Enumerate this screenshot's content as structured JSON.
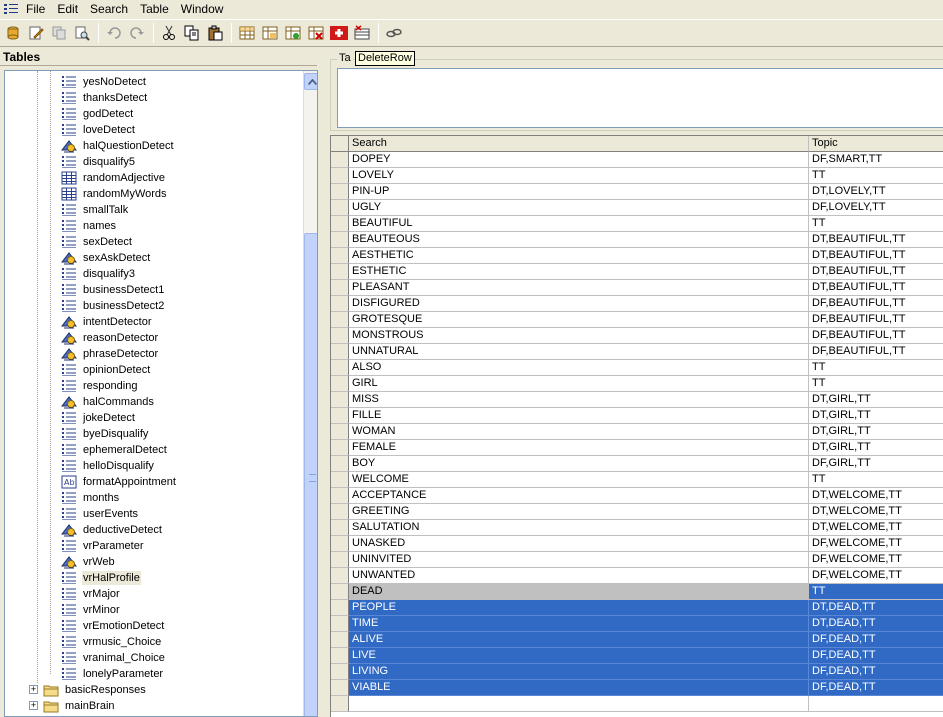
{
  "menu": [
    "File",
    "Edit",
    "Search",
    "Table",
    "Window"
  ],
  "toolbar": {
    "buttons": [
      "db-icon",
      "edit-icon",
      "copy-disabled-icon",
      "find-db-icon",
      "undo-icon",
      "redo-icon",
      "cut-icon",
      "copy-icon",
      "paste-icon",
      "table-icon",
      "table-props-icon",
      "table-add-icon",
      "table-delete-icon",
      "add-row-icon",
      "delete-row-icon",
      "link-icon"
    ]
  },
  "left_panel": {
    "title": "Tables",
    "items": [
      {
        "label": "yesNoDetect",
        "icon": "list-icon"
      },
      {
        "label": "thanksDetect",
        "icon": "list-icon"
      },
      {
        "label": "godDetect",
        "icon": "list-icon"
      },
      {
        "label": "loveDetect",
        "icon": "list-icon"
      },
      {
        "label": "halQuestionDetect",
        "icon": "query-icon"
      },
      {
        "label": "disqualify5",
        "icon": "list-icon"
      },
      {
        "label": "randomAdjective",
        "icon": "grid-icon"
      },
      {
        "label": "randomMyWords",
        "icon": "grid-icon"
      },
      {
        "label": "smallTalk",
        "icon": "list-icon"
      },
      {
        "label": "names",
        "icon": "list-icon"
      },
      {
        "label": "sexDetect",
        "icon": "list-icon"
      },
      {
        "label": "sexAskDetect",
        "icon": "query-icon"
      },
      {
        "label": "disqualify3",
        "icon": "list-icon"
      },
      {
        "label": "businessDetect1",
        "icon": "list-icon"
      },
      {
        "label": "businessDetect2",
        "icon": "list-icon"
      },
      {
        "label": "intentDetector",
        "icon": "query-icon"
      },
      {
        "label": "reasonDetector",
        "icon": "query-icon"
      },
      {
        "label": "phraseDetector",
        "icon": "query-icon"
      },
      {
        "label": "opinionDetect",
        "icon": "list-icon"
      },
      {
        "label": "responding",
        "icon": "list-icon"
      },
      {
        "label": "halCommands",
        "icon": "query-icon"
      },
      {
        "label": "jokeDetect",
        "icon": "list-icon"
      },
      {
        "label": "byeDisqualify",
        "icon": "list-icon"
      },
      {
        "label": "ephemeralDetect",
        "icon": "list-icon"
      },
      {
        "label": "helloDisqualify",
        "icon": "list-icon"
      },
      {
        "label": "formatAppointment",
        "icon": "format-icon"
      },
      {
        "label": "months",
        "icon": "list-icon"
      },
      {
        "label": "userEvents",
        "icon": "list-icon"
      },
      {
        "label": "deductiveDetect",
        "icon": "query-icon"
      },
      {
        "label": "vrParameter",
        "icon": "list-icon"
      },
      {
        "label": "vrWeb",
        "icon": "query-icon"
      },
      {
        "label": "vrHalProfile",
        "icon": "list-icon",
        "selected": true
      },
      {
        "label": "vrMajor",
        "icon": "list-icon"
      },
      {
        "label": "vrMinor",
        "icon": "list-icon"
      },
      {
        "label": "vrEmotionDetect",
        "icon": "list-icon"
      },
      {
        "label": "vrmusic_Choice",
        "icon": "list-icon"
      },
      {
        "label": "vranimal_Choice",
        "icon": "list-icon"
      },
      {
        "label": "lonelyParameter",
        "icon": "list-icon"
      }
    ],
    "folders": [
      {
        "label": "basicResponses",
        "icon": "folder-icon"
      },
      {
        "label": "mainBrain",
        "icon": "folder-icon"
      }
    ]
  },
  "group": {
    "legend": "Ta",
    "tooltip": "DeleteRow"
  },
  "grid": {
    "columns": [
      "Search",
      "Topic"
    ],
    "rows": [
      {
        "search": "DOPEY",
        "topic": "DF,SMART,TT"
      },
      {
        "search": "LOVELY",
        "topic": "TT"
      },
      {
        "search": "PIN-UP",
        "topic": "DT,LOVELY,TT"
      },
      {
        "search": "UGLY",
        "topic": "DF,LOVELY,TT"
      },
      {
        "search": "BEAUTIFUL",
        "topic": "TT"
      },
      {
        "search": "BEAUTEOUS",
        "topic": "DT,BEAUTIFUL,TT"
      },
      {
        "search": "AESTHETIC",
        "topic": "DT,BEAUTIFUL,TT"
      },
      {
        "search": "ESTHETIC",
        "topic": "DT,BEAUTIFUL,TT"
      },
      {
        "search": "PLEASANT",
        "topic": "DT,BEAUTIFUL,TT"
      },
      {
        "search": "DISFIGURED",
        "topic": "DF,BEAUTIFUL,TT"
      },
      {
        "search": "GROTESQUE",
        "topic": "DF,BEAUTIFUL,TT"
      },
      {
        "search": "MONSTROUS",
        "topic": "DF,BEAUTIFUL,TT"
      },
      {
        "search": "UNNATURAL",
        "topic": "DF,BEAUTIFUL,TT"
      },
      {
        "search": "ALSO",
        "topic": "TT"
      },
      {
        "search": "GIRL",
        "topic": "TT"
      },
      {
        "search": "MISS",
        "topic": "DT,GIRL,TT"
      },
      {
        "search": "FILLE",
        "topic": "DT,GIRL,TT"
      },
      {
        "search": "WOMAN",
        "topic": "DT,GIRL,TT"
      },
      {
        "search": "FEMALE",
        "topic": "DT,GIRL,TT"
      },
      {
        "search": "BOY",
        "topic": "DF,GIRL,TT"
      },
      {
        "search": "WELCOME",
        "topic": "TT"
      },
      {
        "search": "ACCEPTANCE",
        "topic": "DT,WELCOME,TT"
      },
      {
        "search": "GREETING",
        "topic": "DT,WELCOME,TT"
      },
      {
        "search": "SALUTATION",
        "topic": "DT,WELCOME,TT"
      },
      {
        "search": "UNASKED",
        "topic": "DF,WELCOME,TT"
      },
      {
        "search": "UNINVITED",
        "topic": "DF,WELCOME,TT"
      },
      {
        "search": "UNWANTED",
        "topic": "DF,WELCOME,TT"
      },
      {
        "search": "DEAD",
        "topic": "TT",
        "state": "current"
      },
      {
        "search": "PEOPLE",
        "topic": "DT,DEAD,TT",
        "state": "selected"
      },
      {
        "search": "TIME",
        "topic": "DT,DEAD,TT",
        "state": "selected"
      },
      {
        "search": "ALIVE",
        "topic": "DF,DEAD,TT",
        "state": "selected"
      },
      {
        "search": "LIVE",
        "topic": "DF,DEAD,TT",
        "state": "selected"
      },
      {
        "search": "LIVING",
        "topic": "DF,DEAD,TT",
        "state": "selected"
      },
      {
        "search": "VIABLE",
        "topic": "DF,DEAD,TT",
        "state": "selected"
      },
      {
        "search": "",
        "topic": ""
      }
    ]
  },
  "colors": {
    "selection": "#316ac5",
    "window_bg": "#ece9d8",
    "scroll": "#c1d3fb"
  }
}
